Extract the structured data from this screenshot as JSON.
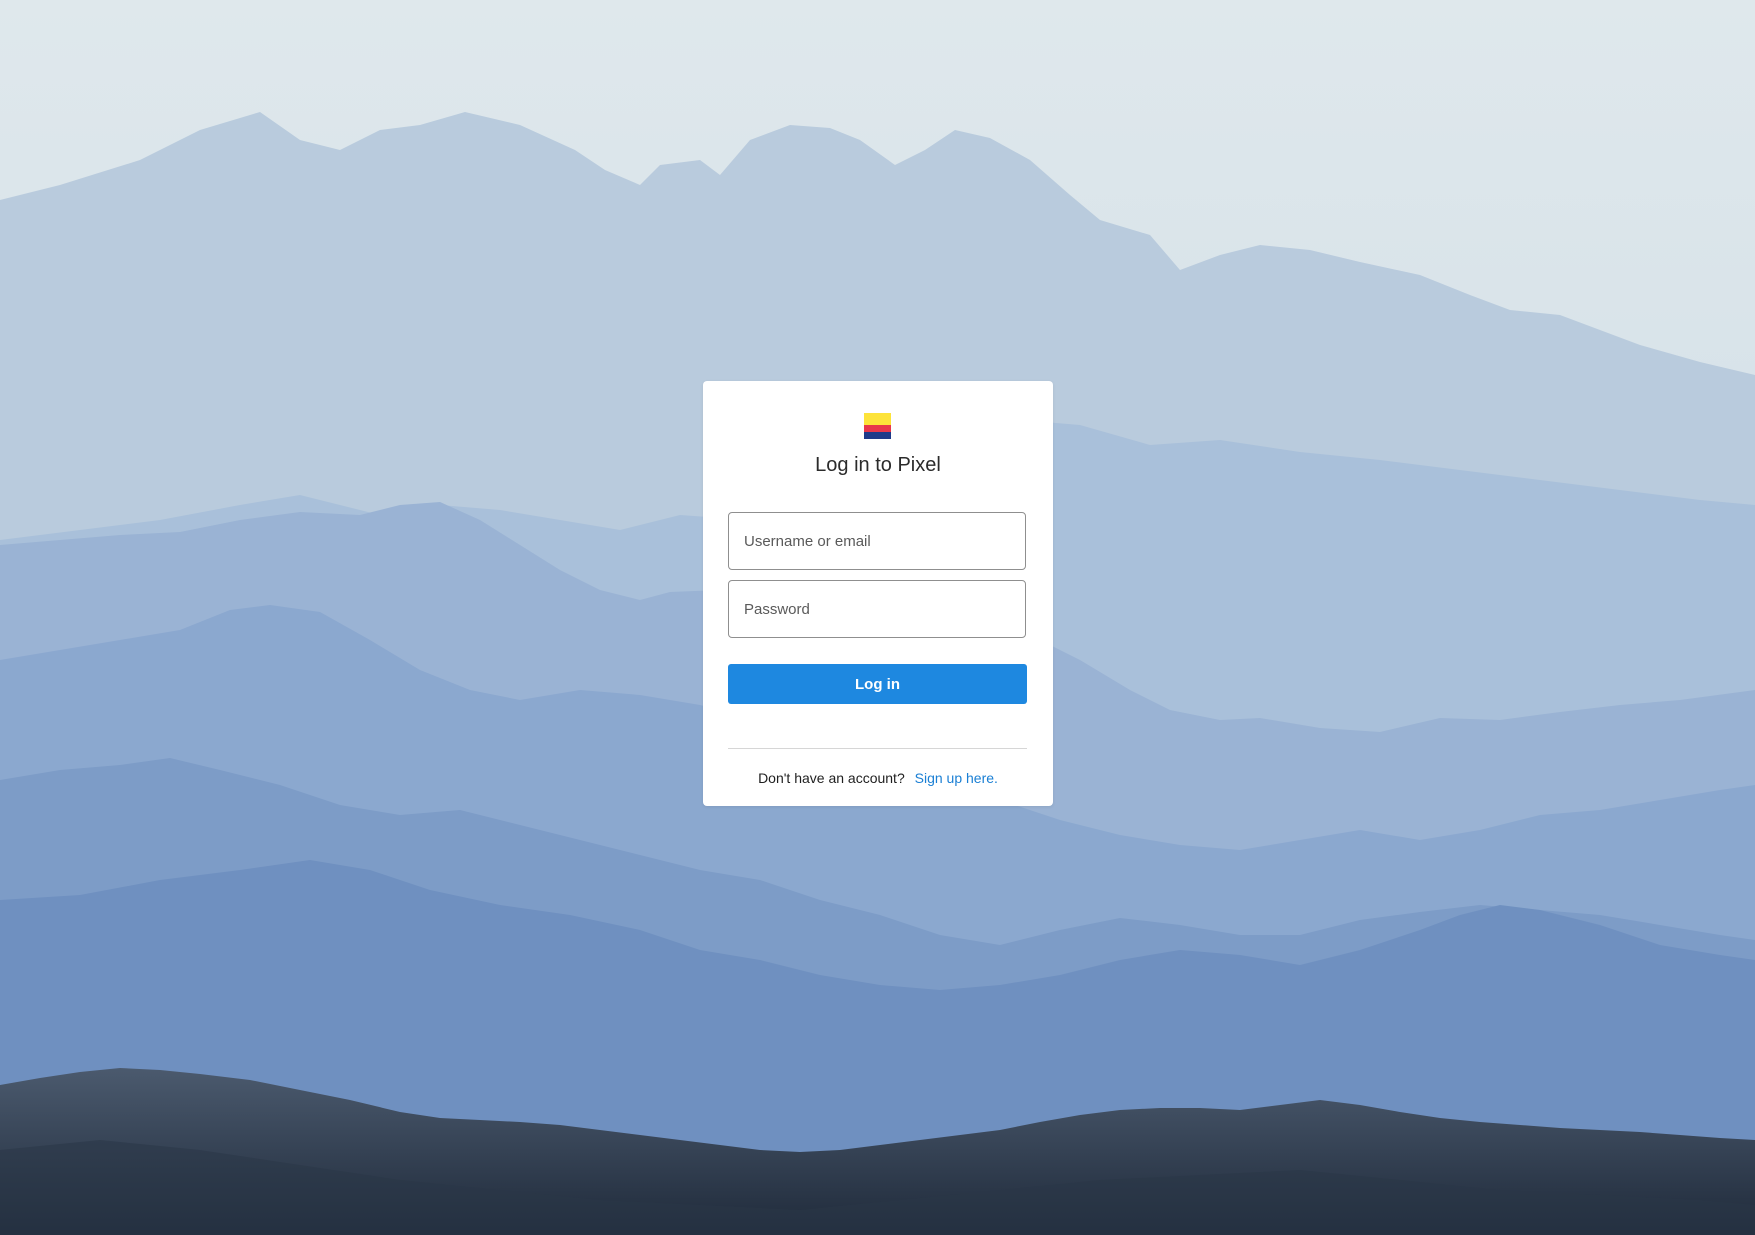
{
  "colors": {
    "accent": "#1e88e0",
    "link": "#1a7fd4",
    "logo_yellow": "#fde33a",
    "logo_red": "#e8374a",
    "logo_blue": "#1e3a8a"
  },
  "background": {
    "icon": "mountain-landscape-image"
  },
  "login": {
    "logo_icon": "pixel-logo-icon",
    "title": "Log in to Pixel",
    "username_placeholder": "Username or email",
    "username_value": "",
    "password_placeholder": "Password",
    "password_value": "",
    "submit_label": "Log in",
    "signup_prompt": "Don't have an account?",
    "signup_link": "Sign up here."
  }
}
